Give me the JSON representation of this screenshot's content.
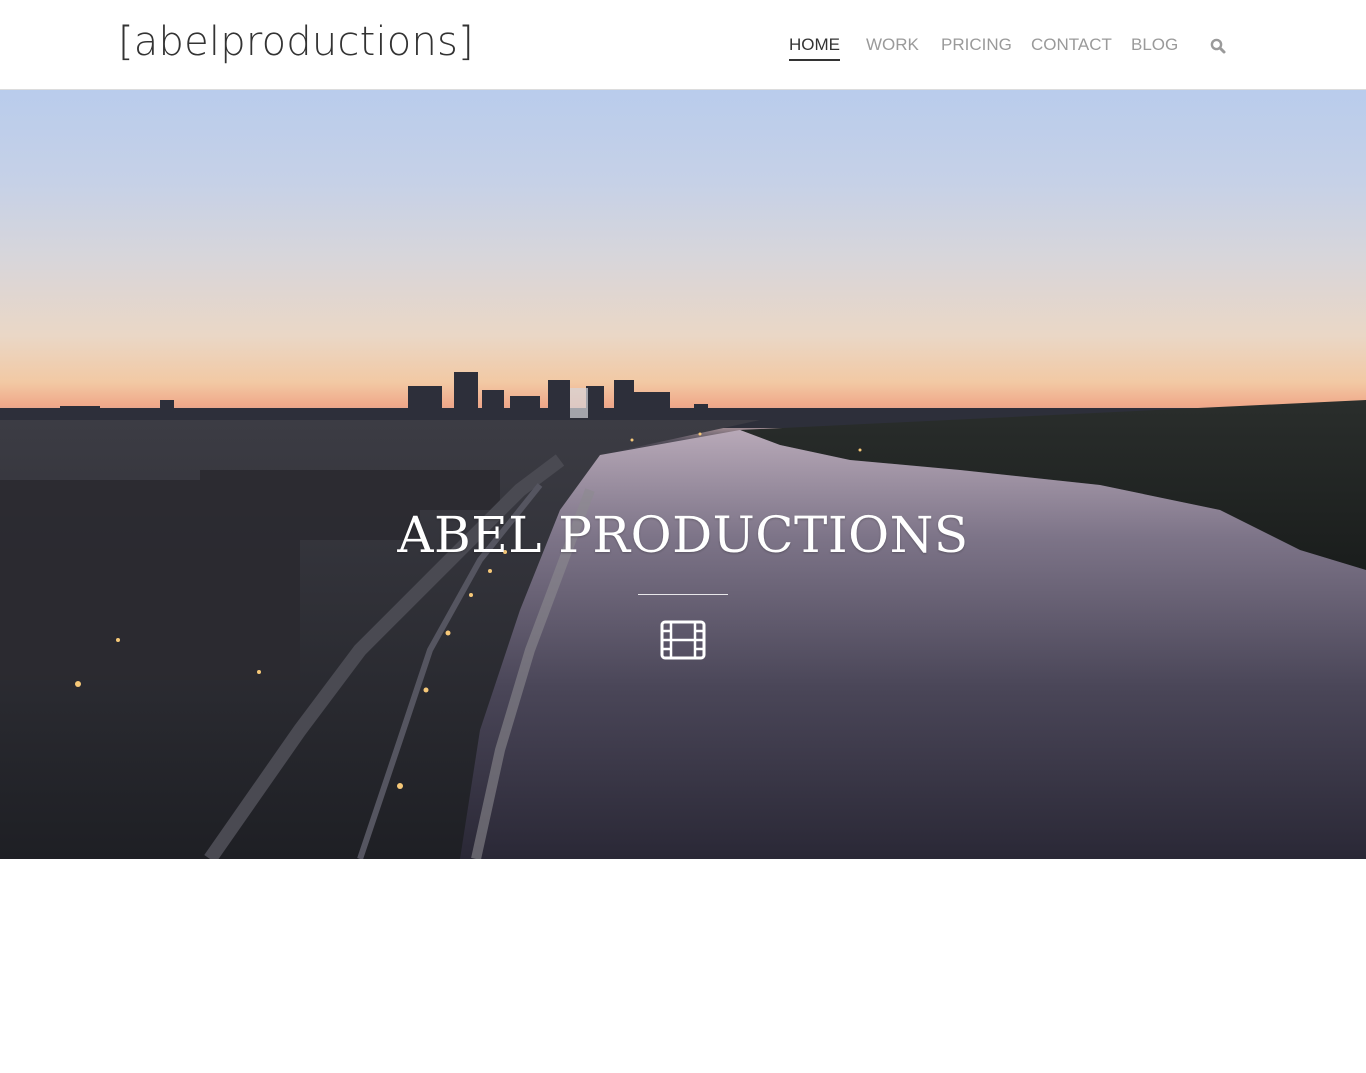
{
  "header": {
    "logo": "[abelproductions]",
    "nav": [
      {
        "label": "HOME",
        "active": true
      },
      {
        "label": "WORK",
        "active": false
      },
      {
        "label": "PRICING",
        "active": false
      },
      {
        "label": "CONTACT",
        "active": false
      },
      {
        "label": "BLOG",
        "active": false
      }
    ],
    "search_icon": "search-icon"
  },
  "hero": {
    "title": "ABEL PRODUCTIONS",
    "icon": "film-icon",
    "background": "aerial city skyline at sunset over a river"
  },
  "colors": {
    "nav_active": "#333333",
    "nav_inactive": "#9a9a9a",
    "hero_text": "#ffffff"
  }
}
